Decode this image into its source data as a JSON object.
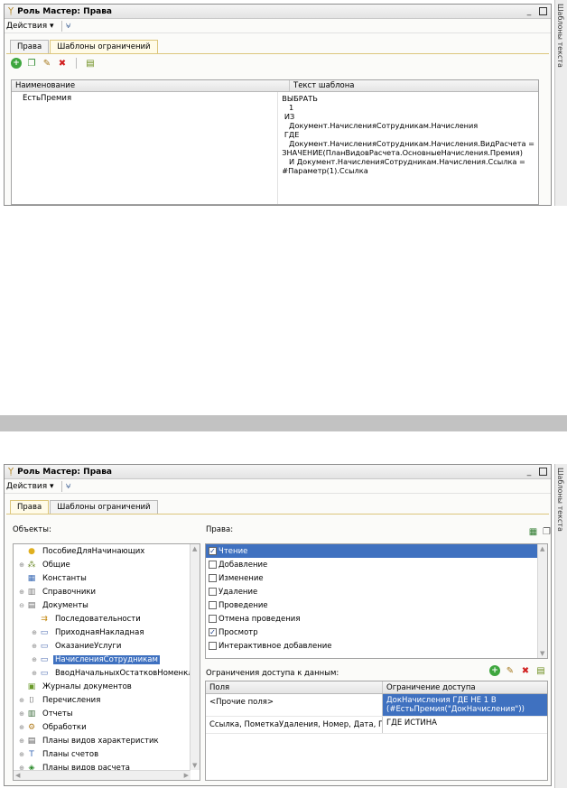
{
  "window_top": {
    "title": "Роль Мастер: Права",
    "actions_label": "Действия ▾",
    "tabs": [
      "Права",
      "Шаблоны ограничений"
    ],
    "grid": {
      "columns": [
        "Наименование",
        "Текст шаблона"
      ],
      "rows": [
        {
          "name": "ЕстьПремия",
          "text": "ВЫБРАТЬ\n   1\n ИЗ\n   Документ.НачисленияСотрудникам.Начисления\n ГДЕ\n   Документ.НачисленияСотрудникам.Начисления.ВидРасчета =\nЗНАЧЕНИЕ(ПланВидовРасчета.ОсновныеНачисления.Премия)\n   И Документ.НачисленияСотрудникам.Начисления.Ссылка =\n#Параметр(1).Ссылка"
        }
      ]
    },
    "side_label": "Шаблоны текста"
  },
  "window_bottom": {
    "title": "Роль Мастер: Права",
    "actions_label": "Действия ▾",
    "tabs": [
      "Права",
      "Шаблоны ограничений"
    ],
    "objects_label": "Объекты:",
    "rights_label": "Права:",
    "restrictions_label": "Ограничения доступа к данным:",
    "side_label": "Шаблоны текста",
    "tree": [
      {
        "label": "ПособиеДляНачинающих",
        "level": 0,
        "icon": "config-icon",
        "expander": ""
      },
      {
        "label": "Общие",
        "level": 0,
        "icon": "common-icon",
        "expander": "⊕"
      },
      {
        "label": "Константы",
        "level": 0,
        "icon": "constants-icon",
        "expander": ""
      },
      {
        "label": "Справочники",
        "level": 0,
        "icon": "catalogs-icon",
        "expander": "⊕"
      },
      {
        "label": "Документы",
        "level": 0,
        "icon": "documents-icon",
        "expander": "⊖"
      },
      {
        "label": "Последовательности",
        "level": 1,
        "icon": "sequence-icon",
        "expander": ""
      },
      {
        "label": "ПриходнаяНакладная",
        "level": 1,
        "icon": "document-icon",
        "expander": "⊕"
      },
      {
        "label": "ОказаниеУслуги",
        "level": 1,
        "icon": "document-icon",
        "expander": "⊕"
      },
      {
        "label": "НачисленияСотрудникам",
        "level": 1,
        "icon": "document-icon",
        "expander": "⊕",
        "selected": true
      },
      {
        "label": "ВводНачальныхОстатковНоменкл",
        "level": 1,
        "icon": "document-icon",
        "expander": "⊕"
      },
      {
        "label": "Журналы документов",
        "level": 0,
        "icon": "journal-icon",
        "expander": ""
      },
      {
        "label": "Перечисления",
        "level": 0,
        "icon": "enum-icon",
        "expander": "⊕"
      },
      {
        "label": "Отчеты",
        "level": 0,
        "icon": "reports-icon",
        "expander": "⊕"
      },
      {
        "label": "Обработки",
        "level": 0,
        "icon": "processing-icon",
        "expander": "⊕"
      },
      {
        "label": "Планы видов характеристик",
        "level": 0,
        "icon": "chart-of-characteristics-icon",
        "expander": "⊕"
      },
      {
        "label": "Планы счетов",
        "level": 0,
        "icon": "chart-of-accounts-icon",
        "expander": "⊕"
      },
      {
        "label": "Планы видов расчета",
        "level": 0,
        "icon": "chart-of-calculation-icon",
        "expander": "⊕"
      }
    ],
    "rights": [
      {
        "label": "Чтение",
        "checked": true,
        "selected": true
      },
      {
        "label": "Добавление",
        "checked": false
      },
      {
        "label": "Изменение",
        "checked": false
      },
      {
        "label": "Удаление",
        "checked": false
      },
      {
        "label": "Проведение",
        "checked": false
      },
      {
        "label": "Отмена проведения",
        "checked": false
      },
      {
        "label": "Просмотр",
        "checked": true
      },
      {
        "label": "Интерактивное добавление",
        "checked": false
      }
    ],
    "restrictions": {
      "columns": [
        "Поля",
        "Ограничение доступа"
      ],
      "rows": [
        {
          "fields": "<Прочие поля>",
          "restriction": "ДокНачисления ГДЕ НЕ 1 В (#ЕстьПремия(\"ДокНачисления\"))",
          "selected": true
        },
        {
          "fields": "Ссылка, ПометкаУдаления, Номер, Дата, П...",
          "restriction": "ГДЕ ИСТИНА",
          "selected": false
        }
      ]
    }
  }
}
